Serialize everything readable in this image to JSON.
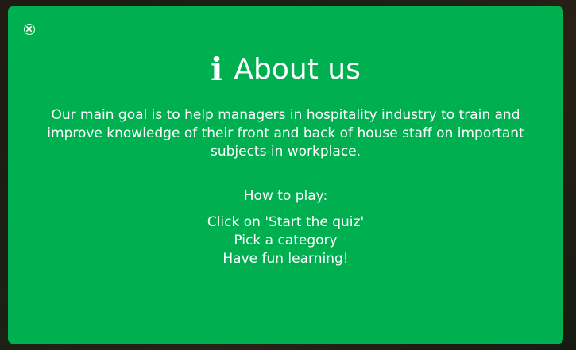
{
  "modal": {
    "close_icon": "close-circle-icon",
    "title_icon": "info-icon",
    "title_icon_glyph": "i",
    "title": "About us",
    "description": "Our main goal is to help managers in hospitality industry to train and improve knowledge of their front and back of house staff on important subjects in workplace.",
    "howto_heading": "How to play:",
    "steps": [
      "Click on 'Start the quiz'",
      "Pick a category",
      "Have fun learning!"
    ]
  },
  "colors": {
    "modal_background": "#00b050",
    "text": "#ffffff"
  }
}
